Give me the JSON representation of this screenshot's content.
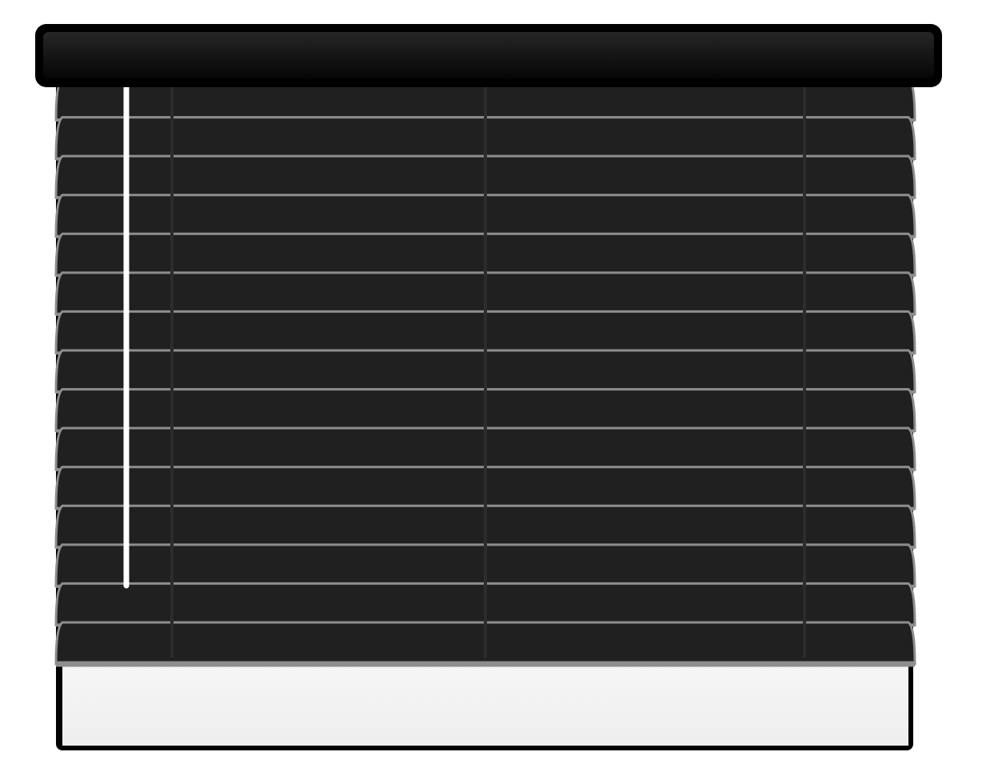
{
  "blinds": {
    "slat_count": 15,
    "open_fraction": 0.11,
    "colors": {
      "slat": "#202020",
      "slat_edge": "#8e8e8e",
      "headrail_top": "#262626",
      "headrail_bottom": "#050505",
      "frame": "#000000",
      "window_glass": "#f1f1f1",
      "ladder_tape": "#2c2c2c",
      "pull_cord": "#ffffff"
    },
    "icons": [
      "window-blinds-icon"
    ]
  }
}
